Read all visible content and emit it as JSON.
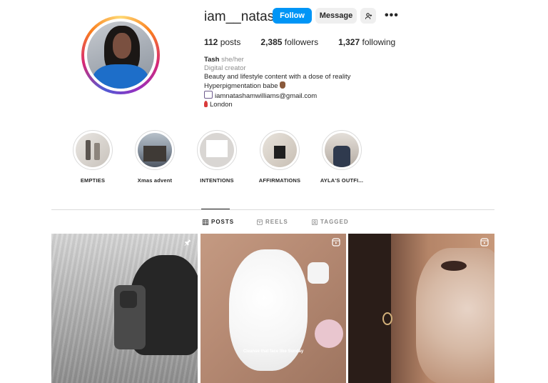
{
  "profile": {
    "username": "iam__natasha",
    "follow_label": "Follow",
    "message_label": "Message",
    "stats": {
      "posts_count": "112",
      "posts_label": "posts",
      "followers_count": "2,385",
      "followers_label": "followers",
      "following_count": "1,327",
      "following_label": "following"
    },
    "bio": {
      "name": "Tash",
      "pronouns": "she/her",
      "category": "Digital creator",
      "line1": "Beauty and lifestyle content with a dose of reality",
      "line2": "Hyperpigmentation babe",
      "email": "iamnatashamwilliams@gmail.com",
      "location": "London"
    }
  },
  "highlights": [
    {
      "label": "EMPTIES"
    },
    {
      "label": "Xmas advent"
    },
    {
      "label": "INTENTIONS"
    },
    {
      "label": "AFFIRMATIONS"
    },
    {
      "label": "AYLA'S OUTFI..."
    }
  ],
  "tabs": {
    "posts": "POSTS",
    "reels": "REELS",
    "tagged": "TAGGED",
    "active": "posts"
  },
  "posts": [
    {
      "badge": "pin-icon"
    },
    {
      "badge": "reel-icon",
      "overlay_text": "Cleanse that face like Sunday"
    },
    {
      "badge": "reel-icon"
    }
  ],
  "colors": {
    "follow_button": "#0095f6",
    "secondary_button": "#efefef",
    "muted_text": "#8e8e8e",
    "divider": "#dbdbdb"
  }
}
